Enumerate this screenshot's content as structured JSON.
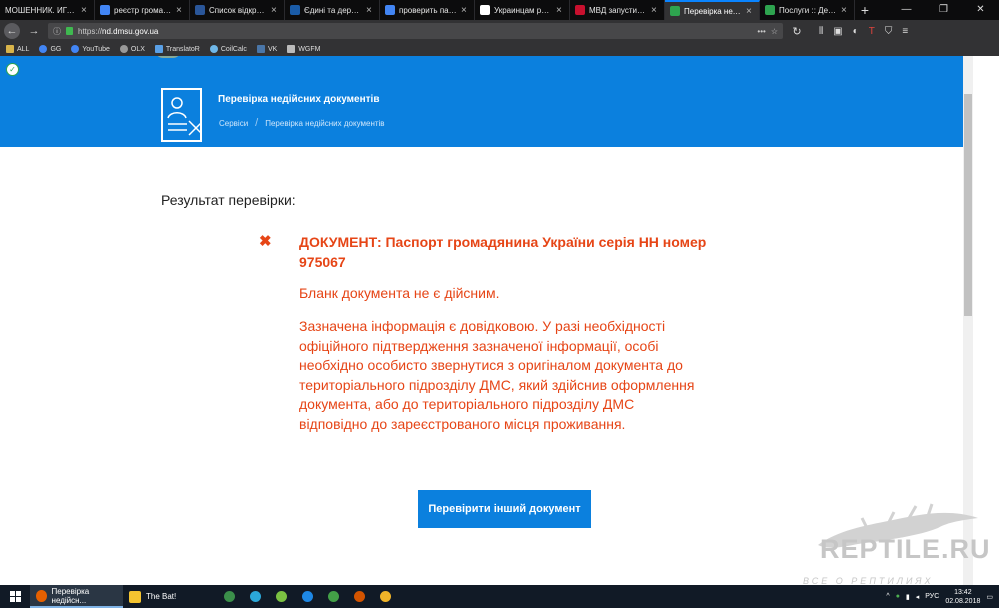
{
  "browser": {
    "tabs": [
      {
        "label": "МОШЕННИК. ИГОРЬ В",
        "favicon_color": "#0c0c0d",
        "active": false
      },
      {
        "label": "реєстр громадян у",
        "favicon_color": "#4285f4",
        "active": false
      },
      {
        "label": "Список відкритих :",
        "favicon_color": "#2a5699",
        "active": false
      },
      {
        "label": "Єдині та державні",
        "favicon_color": "#1a5ca8",
        "active": false
      },
      {
        "label": "проверить паспор",
        "favicon_color": "#4285f4",
        "active": false
      },
      {
        "label": "Украинцам разре",
        "favicon_color": "#ffffff",
        "active": false
      },
      {
        "label": "МВД запустило он",
        "favicon_color": "#c8102e",
        "active": false
      },
      {
        "label": "Перевірка недійс",
        "favicon_color": "#2ea44f",
        "active": true
      },
      {
        "label": "Послуги :: Держа",
        "favicon_color": "#2ea44f",
        "active": false
      }
    ],
    "new_tab": "+",
    "window_controls": {
      "minimize": "—",
      "maximize": "❐",
      "close": "✕"
    },
    "url_scheme": "https://",
    "url_host": "nd.dmsu.gov.ua",
    "page_actions": "•••",
    "bookmarks": [
      "ALL",
      "GG",
      "YouTube",
      "OLX",
      "TranslatoR",
      "CoilCalc",
      "VK",
      "WGFM"
    ]
  },
  "hero": {
    "title": "Перевірка недійсних документів",
    "breadcrumb_root": "Сервіси",
    "breadcrumb_sep": "/",
    "breadcrumb_current": "Перевірка недійсних документів"
  },
  "result": {
    "heading": "Результат перевірки:",
    "status_icon": "✖",
    "document": "ДОКУМЕНТ: Паспорт громадянина України серія НН номер 975067",
    "message_invalid": "Бланк документа не є дійсним.",
    "message_info": "Зазначена інформація є довідковою. У разі необхідності офіційного підтвердження зазначеної інформації, особі необхідно особисто звернутися з оригіналом документа до територіального підрозділу ДМС, який здійснив оформлення документа, або до територіального підрозділу ДМС відповідно до зареєстрованого місця проживання.",
    "check_other_button": "Перевірити інший документ",
    "accent_color": "#e64516"
  },
  "watermark": {
    "brand": "REPTILE.RU",
    "tagline": "ВСЕ О РЕПТИЛИЯХ"
  },
  "taskbar": {
    "items": [
      {
        "label": "Перевірка недійсн...",
        "active": true,
        "icon_color": "#e66000"
      },
      {
        "label": "The Bat!",
        "active": false,
        "icon_color": "#f4c430"
      }
    ],
    "language": "РУС",
    "time": "13:42",
    "date": "02.08.2018"
  }
}
